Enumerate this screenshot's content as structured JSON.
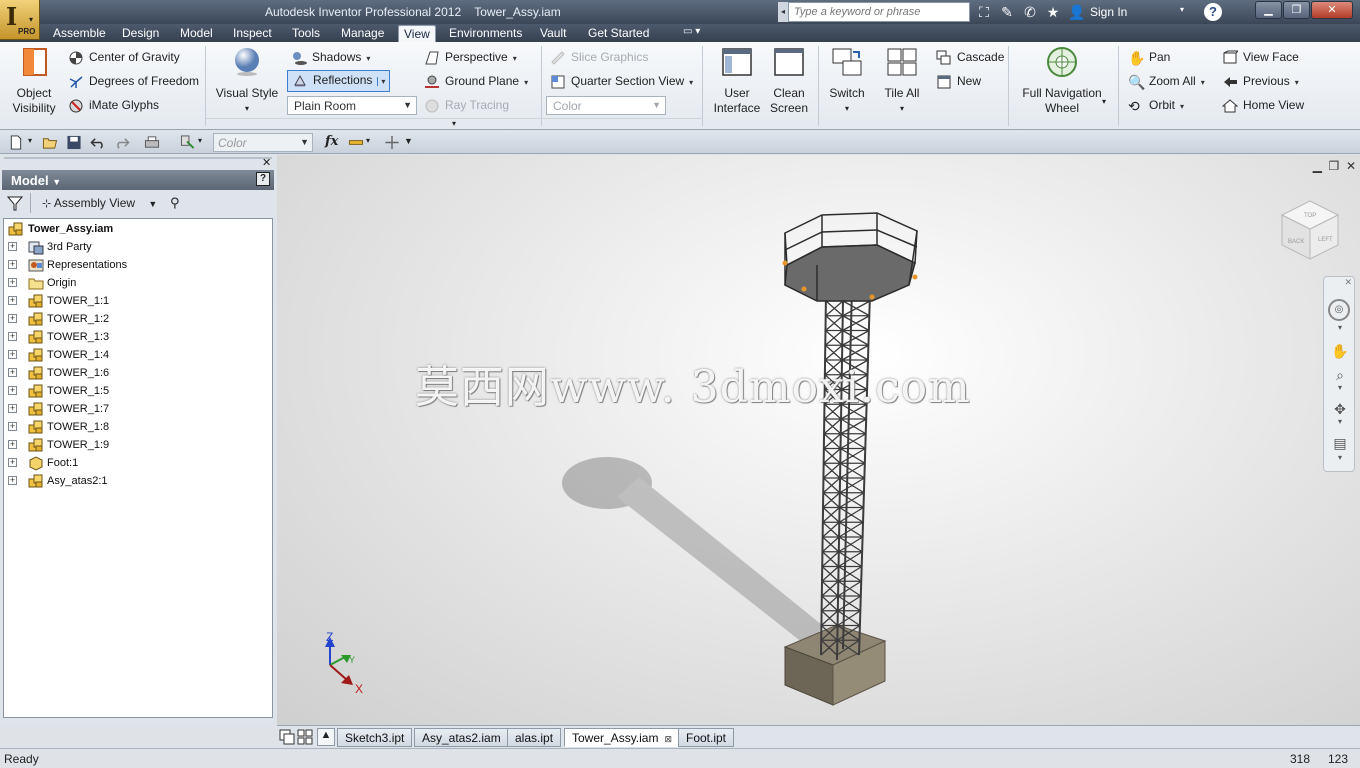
{
  "window": {
    "title": "Autodesk Inventor Professional 2012    Tower_Assy.iam",
    "search_placeholder": "Type a keyword or phrase",
    "sign_in": "Sign In",
    "app_badge": "PRO",
    "app_letter": "I"
  },
  "ribbon_tabs": [
    "Assemble",
    "Design",
    "Model",
    "Inspect",
    "Tools",
    "Manage",
    "View",
    "Environments",
    "Vault",
    "Get Started"
  ],
  "active_tab": "View",
  "ribbon": {
    "object_visibility": "Object Visibility",
    "center_of_gravity": "Center of Gravity",
    "degrees_of_freedom": "Degrees of Freedom",
    "imate_glyphs": "iMate Glyphs",
    "visual_style": "Visual Style",
    "shadows": "Shadows",
    "reflections": "Reflections",
    "lighting_style": "Plain Room",
    "perspective": "Perspective",
    "ground_plane": "Ground Plane",
    "ray_tracing": "Ray Tracing",
    "slice_graphics": "Slice Graphics",
    "quarter_section_view": "Quarter Section View",
    "color_override": "Color",
    "user_interface": "User Interface",
    "clean_screen": "Clean Screen",
    "switch": "Switch",
    "tile_all": "Tile All",
    "cascade": "Cascade",
    "new_window": "New",
    "full_navigation_wheel": "Full Navigation Wheel",
    "pan": "Pan",
    "zoom_all": "Zoom All",
    "orbit": "Orbit",
    "view_face": "View Face",
    "previous": "Previous",
    "home_view": "Home View"
  },
  "qat": {
    "color": "Color"
  },
  "browser": {
    "title": "Model",
    "help": "?",
    "view_mode": "Assembly View",
    "tree": [
      {
        "label": "Tower_Assy.iam",
        "root": true,
        "icon": "assembly-icon"
      },
      {
        "label": "3rd Party",
        "icon": "third-party-icon"
      },
      {
        "label": "Representations",
        "icon": "representations-icon"
      },
      {
        "label": "Origin",
        "icon": "folder-icon"
      },
      {
        "label": "TOWER_1:1",
        "icon": "assembly-icon"
      },
      {
        "label": "TOWER_1:2",
        "icon": "assembly-icon"
      },
      {
        "label": "TOWER_1:3",
        "icon": "assembly-icon"
      },
      {
        "label": "TOWER_1:4",
        "icon": "assembly-icon"
      },
      {
        "label": "TOWER_1:6",
        "icon": "assembly-icon"
      },
      {
        "label": "TOWER_1:5",
        "icon": "assembly-icon"
      },
      {
        "label": "TOWER_1:7",
        "icon": "assembly-icon"
      },
      {
        "label": "TOWER_1:8",
        "icon": "assembly-icon"
      },
      {
        "label": "TOWER_1:9",
        "icon": "assembly-icon"
      },
      {
        "label": "Foot:1",
        "icon": "part-icon"
      },
      {
        "label": "Asy_atas2:1",
        "icon": "assembly-icon"
      }
    ]
  },
  "viewport": {
    "watermark": "莫西网www. 3dmoxi.com",
    "viewcube_faces": {
      "top": "TOP",
      "front": "BACK",
      "right": "LEFT"
    },
    "triad": {
      "z": "Z",
      "y": "Y",
      "x": "X"
    }
  },
  "doc_tabs": [
    "Sketch3.ipt",
    "Asy_atas2.iam",
    "alas.ipt",
    "Tower_Assy.iam",
    "Foot.ipt"
  ],
  "active_doc": "Tower_Assy.iam",
  "status": {
    "text": "Ready",
    "x": "318",
    "y": "123"
  },
  "colors": {
    "accent": "#3c7fd0",
    "title_bar": "#4a5668",
    "ribbon_bg": "#eef2f6"
  }
}
